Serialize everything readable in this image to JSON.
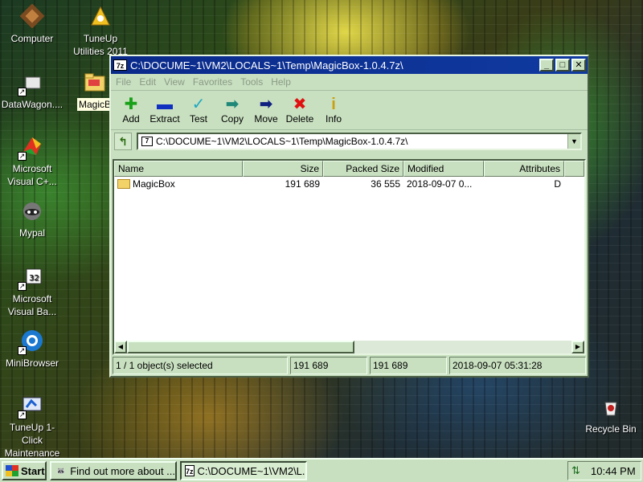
{
  "desktop": {
    "icons": [
      {
        "label": "Computer",
        "icon": "computer-icon"
      },
      {
        "label": "TuneUp Utilities 2011",
        "icon": "tuneup-icon"
      },
      {
        "label": "DataWagon....",
        "icon": "datawagon-icon"
      },
      {
        "label": "MagicB",
        "icon": "folder-icon"
      },
      {
        "label": "Microsoft Visual C+...",
        "icon": "visual-cpp-icon"
      },
      {
        "label": "Mypal",
        "icon": "mypal-icon"
      },
      {
        "label": "Microsoft Visual Ba...",
        "icon": "visual-basic-icon"
      },
      {
        "label": "MiniBrowser",
        "icon": "minibrowser-icon"
      },
      {
        "label": "TuneUp 1-Click Maintenance",
        "icon": "tuneup-1click-icon"
      },
      {
        "label": "Recycle Bin",
        "icon": "recycle-bin-icon"
      }
    ]
  },
  "window": {
    "title": "C:\\DOCUME~1\\VM2\\LOCALS~1\\Temp\\MagicBox-1.0.4.7z\\",
    "menu": [
      "File",
      "Edit",
      "View",
      "Favorites",
      "Tools",
      "Help"
    ],
    "toolbar": [
      {
        "label": "Add",
        "icon": "add-icon",
        "color": "#18a018"
      },
      {
        "label": "Extract",
        "icon": "extract-icon",
        "color": "#1030c0"
      },
      {
        "label": "Test",
        "icon": "test-icon",
        "color": "#20a8c0"
      },
      {
        "label": "Copy",
        "icon": "copy-icon",
        "color": "#208878"
      },
      {
        "label": "Move",
        "icon": "move-icon",
        "color": "#102080"
      },
      {
        "label": "Delete",
        "icon": "delete-icon",
        "color": "#e01010"
      },
      {
        "label": "Info",
        "icon": "info-icon",
        "color": "#c8a010"
      }
    ],
    "address": "C:\\DOCUME~1\\VM2\\LOCALS~1\\Temp\\MagicBox-1.0.4.7z\\",
    "columns": [
      "Name",
      "Size",
      "Packed Size",
      "Modified",
      "Attributes"
    ],
    "rows": [
      {
        "name": "MagicBox",
        "size": "191 689",
        "packed": "36 555",
        "modified": "2018-09-07 0...",
        "attributes": "D"
      }
    ],
    "status": {
      "selected": "1 / 1 object(s) selected",
      "size": "191 689",
      "size2": "191 689",
      "modified": "2018-09-07 05:31:28"
    }
  },
  "taskbar": {
    "start": "Start",
    "tasks": [
      {
        "label": "Find out more about ...",
        "icon": "raccoon-icon"
      },
      {
        "label": "C:\\DOCUME~1\\VM2\\L...",
        "icon": "7z-icon"
      }
    ],
    "clock": "10:44 PM"
  }
}
